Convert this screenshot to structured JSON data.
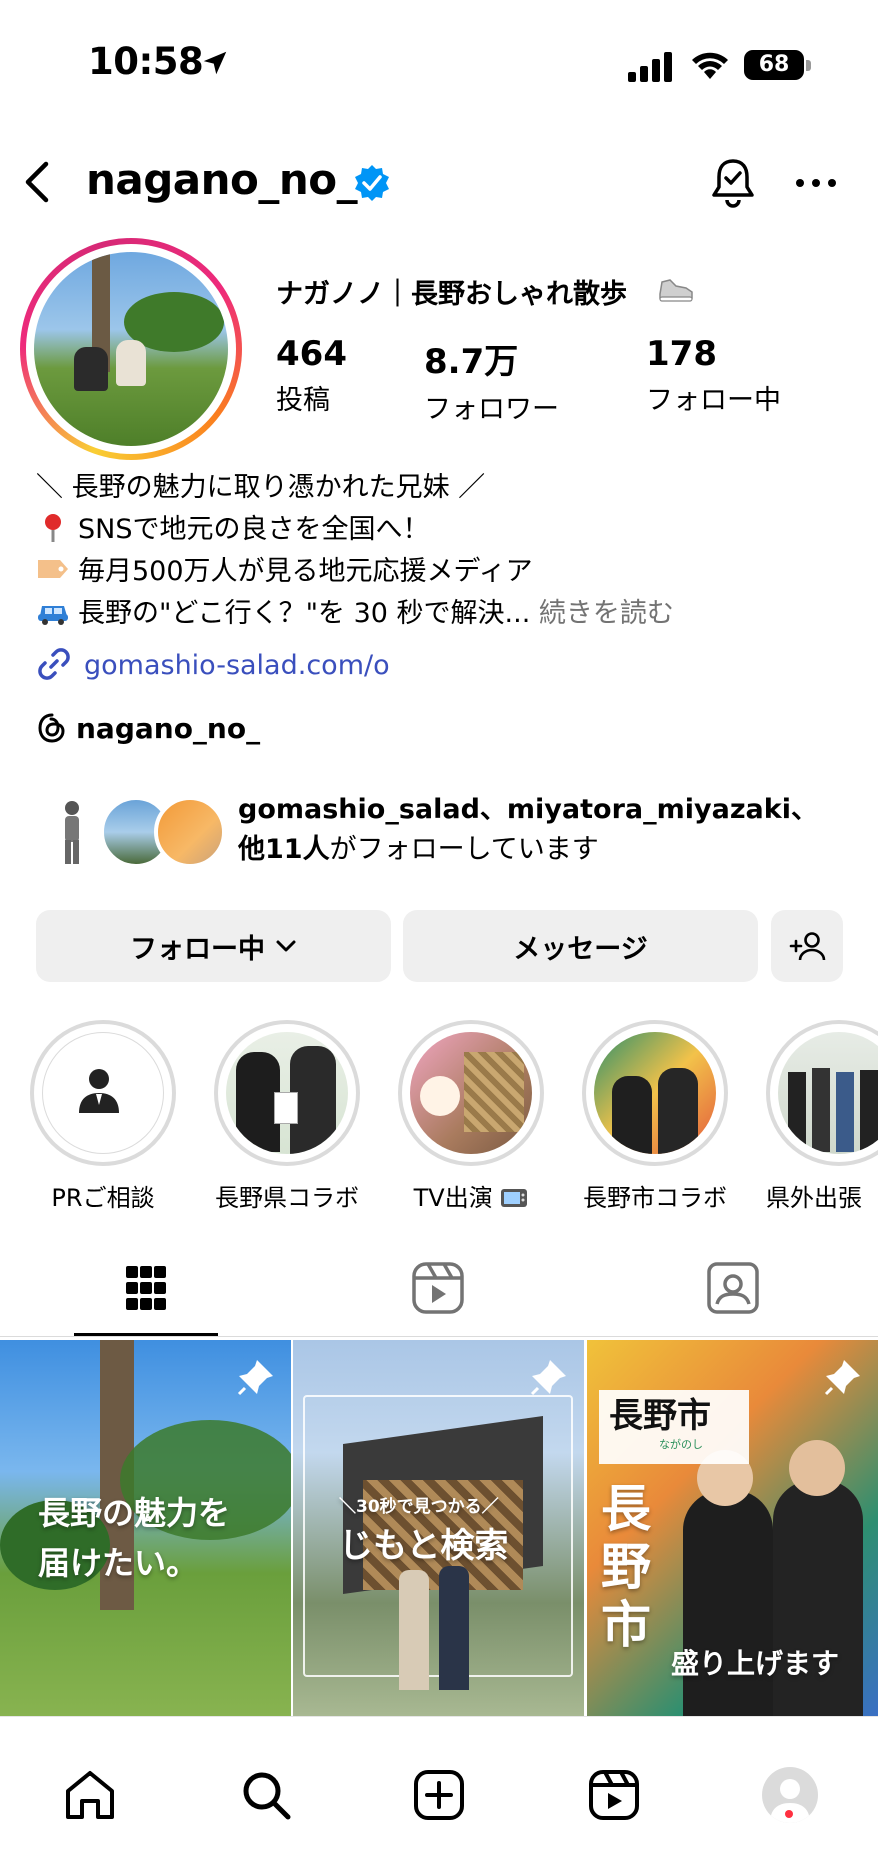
{
  "status_bar": {
    "time": "10:58",
    "battery": "68"
  },
  "header": {
    "username": "nagano_no_"
  },
  "profile": {
    "display_name": "ナガノノ｜長野おしゃれ散歩",
    "stats": [
      {
        "value": "464",
        "label": "投稿"
      },
      {
        "value": "8.7万",
        "label": "フォロワー"
      },
      {
        "value": "178",
        "label": "フォロー中"
      }
    ],
    "bio": {
      "line1": "＼ 長野の魅力に取り憑かれた兄妹 ／",
      "line2": "SNSで地元の良さを全国へ！",
      "line3": "毎月500万人が見る地元応援メディア",
      "line4": "長野の\"どこ行く？\"を 30 秒で解決...",
      "more": "続きを読む"
    },
    "link": "gomashio-salad.com/o",
    "threads": "nagano_no_"
  },
  "followed_by": {
    "names": "gomashio_salad、miyatora_miyazaki、",
    "others": "他11人",
    "suffix": "がフォローしています"
  },
  "actions": {
    "following": "フォロー中",
    "message": "メッセージ"
  },
  "highlights": [
    {
      "label": "PRご相談"
    },
    {
      "label": "長野県コラボ"
    },
    {
      "label": "TV出演"
    },
    {
      "label": "長野市コラボ"
    },
    {
      "label": "県外出張"
    }
  ],
  "posts": [
    {
      "caption_line1": "長野の魅力を",
      "caption_line2": "届けたい。"
    },
    {
      "caption_small": "＼30秒で見つかる／",
      "caption_line1": "じもと検索"
    },
    {
      "banner": "長野市",
      "banner_small": "ながのし",
      "caption_big": "長野市",
      "caption_line1": "盛り上げます"
    }
  ],
  "colors": {
    "link": "#3a4fbd",
    "verified": "#0095f6",
    "button_bg": "#efefef",
    "notification_dot": "#ff3040"
  }
}
